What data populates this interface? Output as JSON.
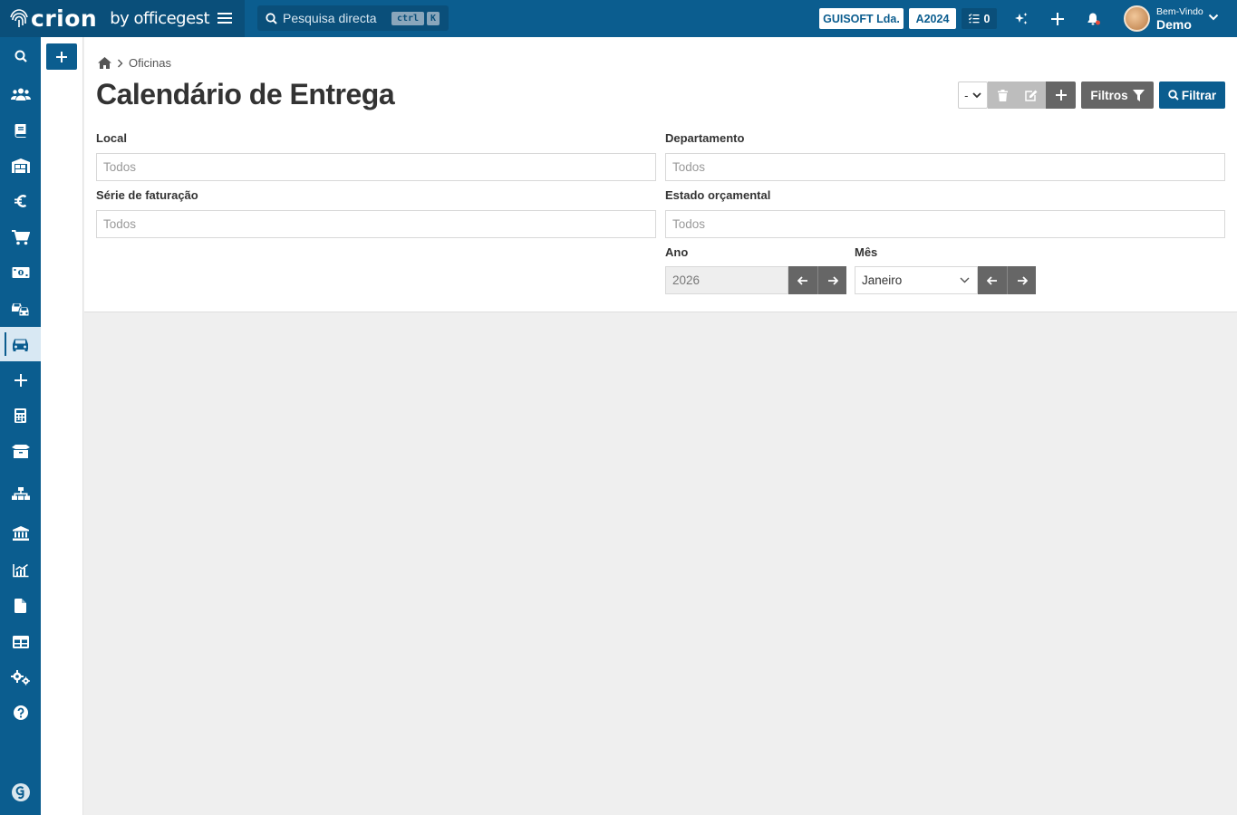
{
  "topbar": {
    "brand": "crion",
    "brand_suffix": "by officegest",
    "search_placeholder": "Pesquisa directa",
    "kbd_ctrl": "ctrl",
    "kbd_k": "K",
    "company": "GUISOFT Lda.",
    "year": "A2024",
    "tasks_count": "0",
    "welcome_label": "Bem-Vindo",
    "user_name": "Demo"
  },
  "sidebar": {
    "items": [
      {
        "icon": "search-icon"
      },
      {
        "icon": "users-icon"
      },
      {
        "icon": "book-icon"
      },
      {
        "icon": "warehouse-icon"
      },
      {
        "icon": "euro-icon"
      },
      {
        "icon": "cart-icon"
      },
      {
        "icon": "money-icon"
      },
      {
        "icon": "cars-icon"
      },
      {
        "icon": "car-icon",
        "active": true
      },
      {
        "icon": "plus-icon"
      },
      {
        "icon": "calculator-icon"
      },
      {
        "icon": "box-icon"
      },
      {
        "icon": "sitemap-icon"
      },
      {
        "icon": "bank-icon"
      },
      {
        "icon": "chart-icon"
      },
      {
        "icon": "file-icon"
      },
      {
        "icon": "table-icon"
      },
      {
        "icon": "cogs-icon"
      },
      {
        "icon": "help-icon"
      },
      {
        "icon": "g-logo-icon"
      }
    ]
  },
  "breadcrumb": {
    "section": "Oficinas"
  },
  "page": {
    "title": "Calendário de Entrega"
  },
  "toolbar": {
    "select_value": "-",
    "filtros_label": "Filtros",
    "filtrar_label": "Filtrar"
  },
  "form": {
    "local": {
      "label": "Local",
      "placeholder": "Todos"
    },
    "departamento": {
      "label": "Departamento",
      "placeholder": "Todos"
    },
    "serie": {
      "label": "Série de faturação",
      "placeholder": "Todos"
    },
    "estado": {
      "label": "Estado orçamental",
      "placeholder": "Todos"
    },
    "ano": {
      "label": "Ano",
      "value": "2026"
    },
    "mes": {
      "label": "Mês",
      "value": "Janeiro"
    }
  },
  "colors": {
    "primary": "#0b5d8f",
    "primary_dark": "#0a4f7a",
    "button_gray": "#666666"
  }
}
